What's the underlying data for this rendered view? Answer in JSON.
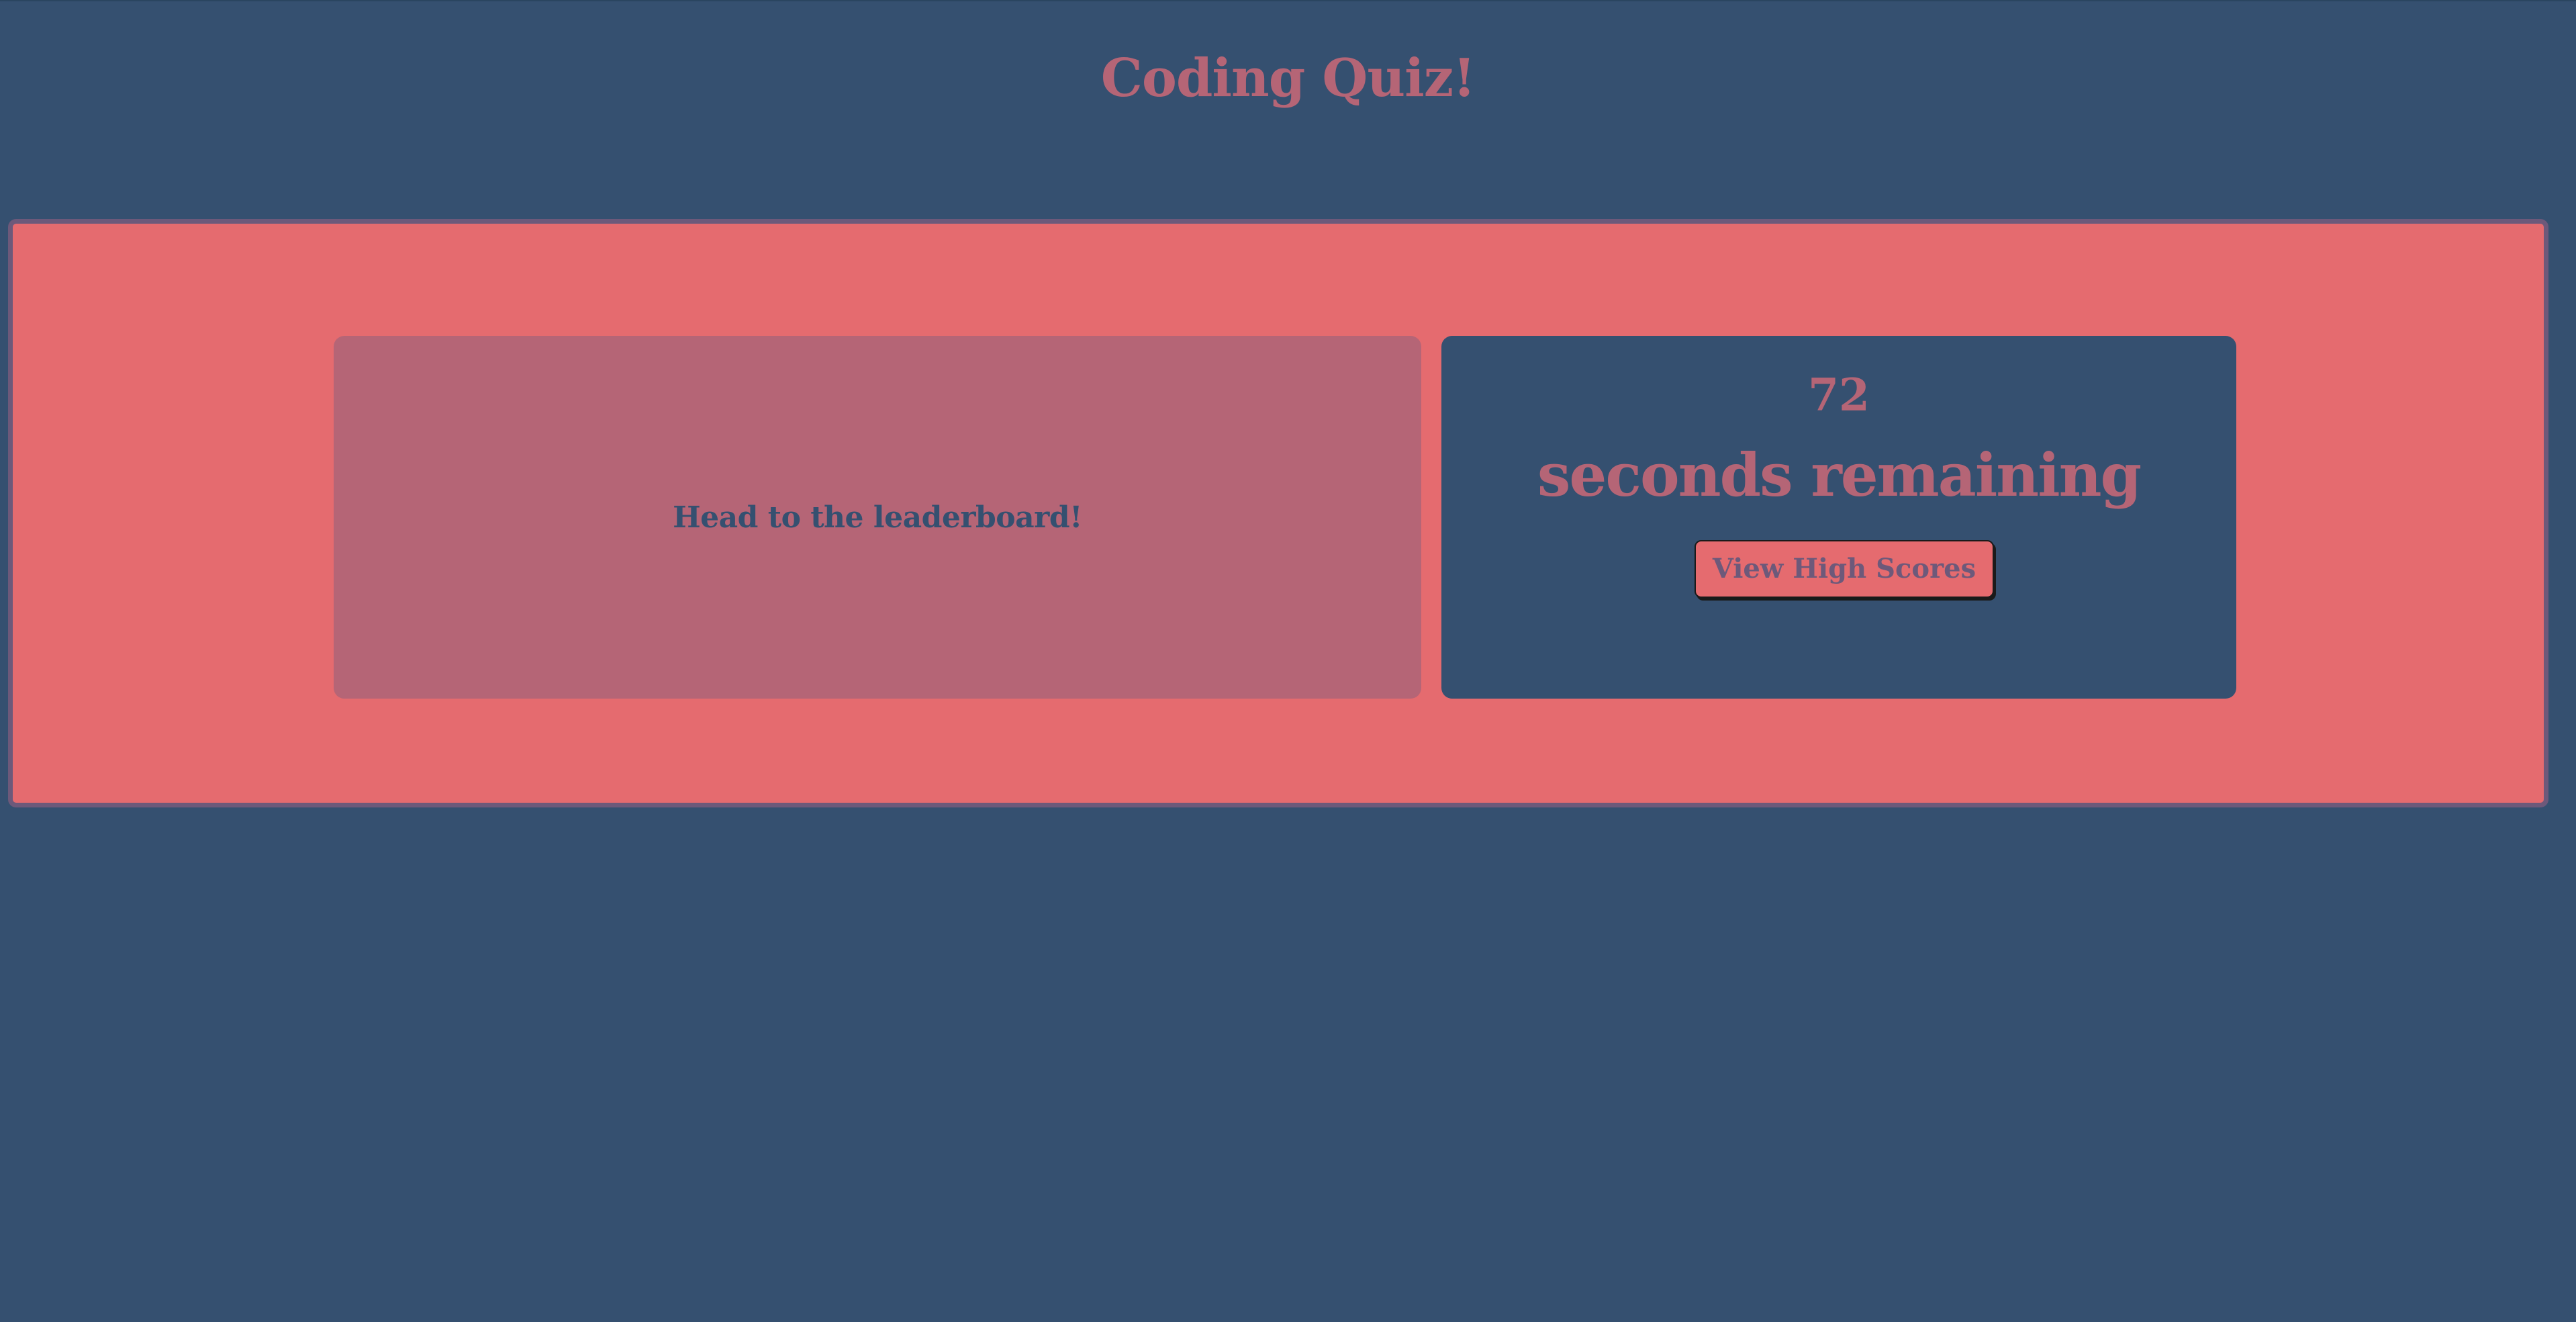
{
  "header": {
    "title": "Coding Quiz!"
  },
  "quiz": {
    "message": "Head to the leaderboard!"
  },
  "timer": {
    "seconds": "72",
    "label": "seconds remaining",
    "highscores_button_label": "View High Scores"
  },
  "colors": {
    "background": "#355070",
    "accent_coral": "#e56b6f",
    "accent_rose": "#b56576",
    "accent_purple": "#6d597a"
  }
}
